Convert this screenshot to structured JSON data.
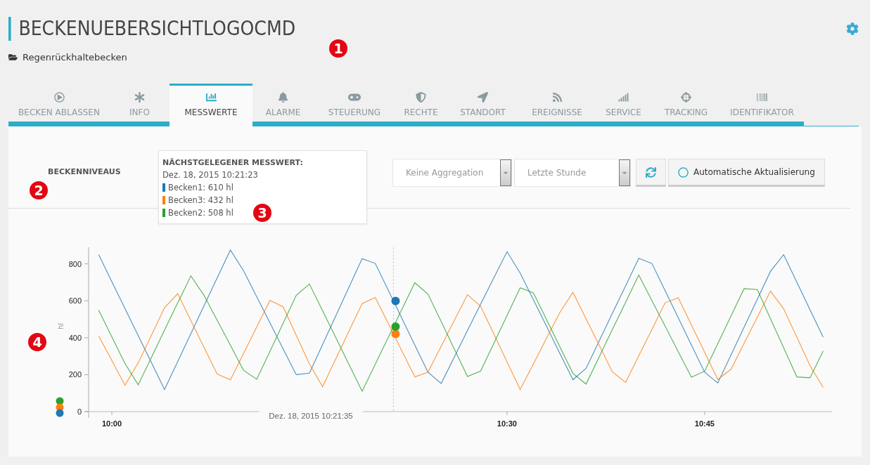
{
  "header": {
    "title": "BECKENUEBERSICHTLOGOCMD",
    "breadcrumb": "Regenrückhaltebecken"
  },
  "tabs": [
    {
      "label": "BECKEN ABLASSEN",
      "selected": false
    },
    {
      "label": "INFO",
      "selected": false
    },
    {
      "label": "MESSWERTE",
      "selected": true
    },
    {
      "label": "ALARME",
      "selected": false
    },
    {
      "label": "STEUERUNG",
      "selected": false
    },
    {
      "label": "RECHTE",
      "selected": false
    },
    {
      "label": "STANDORT",
      "selected": false
    },
    {
      "label": "EREIGNISSE",
      "selected": false
    },
    {
      "label": "SERVICE",
      "selected": false
    },
    {
      "label": "TRACKING",
      "selected": false
    },
    {
      "label": "IDENTIFIKATOR",
      "selected": false
    }
  ],
  "section_title": "BECKENNIVEAUS",
  "tooltip": {
    "title": "NÄCHSTGELEGENER MESSWERT:",
    "time": "Dez. 18, 2015 10:21:23",
    "entries": [
      {
        "label": "Becken1: 610 hl",
        "color": "#1f77b4"
      },
      {
        "label": "Becken3: 432 hl",
        "color": "#ff7f0e"
      },
      {
        "label": "Becken2: 508 hl",
        "color": "#2ca02c"
      }
    ]
  },
  "controls": {
    "aggregation": "Keine Aggregation",
    "range": "Letzte Stunde",
    "auto_update": {
      "label": "Automatische Aktualisierung",
      "checked": false
    }
  },
  "callouts": [
    "1",
    "2",
    "3",
    "4"
  ],
  "chart": {
    "chart_data": {
      "type": "line",
      "ylabel": "hl",
      "categories": [
        null,
        "10:00",
        null,
        null,
        null,
        null,
        null,
        null,
        null,
        null,
        null,
        null,
        null,
        null,
        null,
        null,
        null,
        null,
        null,
        null,
        null,
        null,
        null,
        null,
        null,
        null,
        null,
        null,
        null,
        null,
        null,
        "10:30",
        null,
        null,
        null,
        null,
        null,
        null,
        null,
        null,
        null,
        null,
        null,
        null,
        null,
        null,
        "10:45",
        null,
        null,
        null,
        null,
        null,
        null,
        null,
        null,
        null
      ],
      "series": [
        {
          "color": "#1f77b4",
          "values": [
            850,
            704,
            558,
            412,
            266,
            120,
            271,
            422,
            573,
            724,
            875,
            763,
            622,
            481,
            340,
            200,
            208,
            363,
            518,
            673,
            828,
            802,
            655,
            508,
            360,
            213,
            153,
            296,
            439,
            582,
            725,
            866,
            750,
            606,
            462,
            317,
            173,
            234,
            383,
            532,
            681,
            830,
            802,
            655,
            508,
            360,
            213,
            155,
            306,
            457,
            608,
            759,
            850,
            701,
            552,
            403
          ]
        },
        {
          "color": "#ff7f0e",
          "values": [
            410,
            277,
            143,
            264,
            413,
            563,
            639,
            493,
            348,
            203,
            172,
            315,
            458,
            602,
            568,
            414,
            259,
            135,
            285,
            435,
            585,
            618,
            475,
            331,
            188,
            214,
            354,
            494,
            633,
            570,
            420,
            270,
            120,
            258,
            397,
            535,
            646,
            502,
            359,
            215,
            158,
            302,
            445,
            589,
            616,
            469,
            321,
            174,
            229,
            370,
            511,
            652,
            557,
            403,
            249,
            130
          ]
        },
        {
          "color": "#2ca02c",
          "values": [
            550,
            405,
            260,
            145,
            293,
            441,
            589,
            735,
            629,
            494,
            359,
            224,
            175,
            326,
            478,
            629,
            691,
            546,
            401,
            256,
            110,
            257,
            404,
            551,
            698,
            636,
            488,
            339,
            190,
            220,
            370,
            520,
            670,
            643,
            498,
            353,
            207,
            149,
            297,
            445,
            592,
            740,
            601,
            463,
            324,
            186,
            219,
            368,
            517,
            666,
            661,
            503,
            346,
            188,
            183,
            328
          ]
        }
      ],
      "yticks": [
        0,
        200,
        400,
        600,
        800
      ],
      "ylim": [
        0,
        890
      ]
    },
    "hover": {
      "label": "Dez. 18, 2015 10:21:35"
    }
  }
}
